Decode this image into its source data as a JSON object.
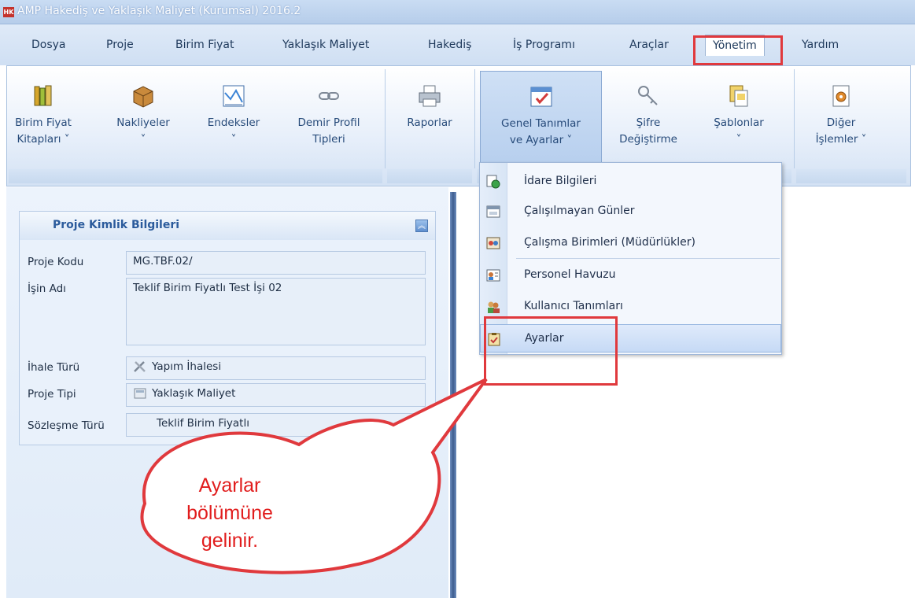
{
  "app": {
    "title": "AMP Hakediş ve Yaklaşık Maliyet (Kurumsal) 2016.2",
    "logo_text": "HK"
  },
  "menu": {
    "items": [
      "Dosya",
      "Proje",
      "Birim Fiyat",
      "Yaklaşık Maliyet",
      "Hakediş",
      "İş Programı",
      "Araçlar",
      "Yönetim",
      "Yardım"
    ],
    "active": "Yönetim"
  },
  "ribbon": {
    "buttons": [
      {
        "line1": "Birim Fiyat",
        "line2": "Kitapları ˅",
        "icon": "books-icon"
      },
      {
        "line1": "Nakliyeler",
        "line2": "˅",
        "icon": "box-icon"
      },
      {
        "line1": "Endeksler",
        "line2": "˅",
        "icon": "chart-icon"
      },
      {
        "line1": "Demir Profil",
        "line2": "Tipleri",
        "icon": "chain-icon"
      },
      {
        "line1": "Raporlar",
        "line2": "",
        "icon": "printer-icon"
      },
      {
        "line1": "Genel Tanımlar",
        "line2": "ve Ayarlar ˅",
        "icon": "settings-window-icon"
      },
      {
        "line1": "Şifre",
        "line2": "Değiştirme",
        "icon": "key-icon"
      },
      {
        "line1": "Şablonlar",
        "line2": "˅",
        "icon": "templates-icon"
      },
      {
        "line1": "Diğer",
        "line2": "İşlemler ˅",
        "icon": "gear-doc-icon"
      }
    ]
  },
  "dropdown": {
    "items": [
      {
        "label": "İdare Bilgileri",
        "icon": "admin-info-icon"
      },
      {
        "label": "Çalışılmayan Günler",
        "icon": "calendar-icon"
      },
      {
        "label": "Çalışma Birimleri (Müdürlükler)",
        "icon": "departments-icon"
      },
      {
        "label": "Personel Havuzu",
        "icon": "personnel-icon"
      },
      {
        "label": "Kullanıcı Tanımları",
        "icon": "users-icon"
      },
      {
        "label": "Ayarlar",
        "icon": "settings-clipboard-icon"
      }
    ],
    "highlighted": "Ayarlar"
  },
  "project_panel": {
    "title": "Proje Kimlik Bilgileri",
    "fields": [
      {
        "label": "Proje Kodu",
        "value": "MG.TBF.02/"
      },
      {
        "label": "İşin Adı",
        "value": "Teklif Birim Fiyatlı Test İşi 02"
      },
      {
        "label": "İhale Türü",
        "value": "Yapım İhalesi",
        "icon": "tools-icon"
      },
      {
        "label": "Proje Tipi",
        "value": "Yaklaşık Maliyet",
        "icon": "calculator-icon"
      },
      {
        "label": "Sözleşme Türü",
        "value": "Teklif Birim Fiyatlı"
      }
    ]
  },
  "callout": {
    "line1": "Ayarlar",
    "line2": "bölümüne",
    "line3": "gelinir."
  },
  "colors": {
    "annotation_red": "#e0393d",
    "callout_text": "#e11d1d",
    "splitter": "#3e5d8f"
  }
}
